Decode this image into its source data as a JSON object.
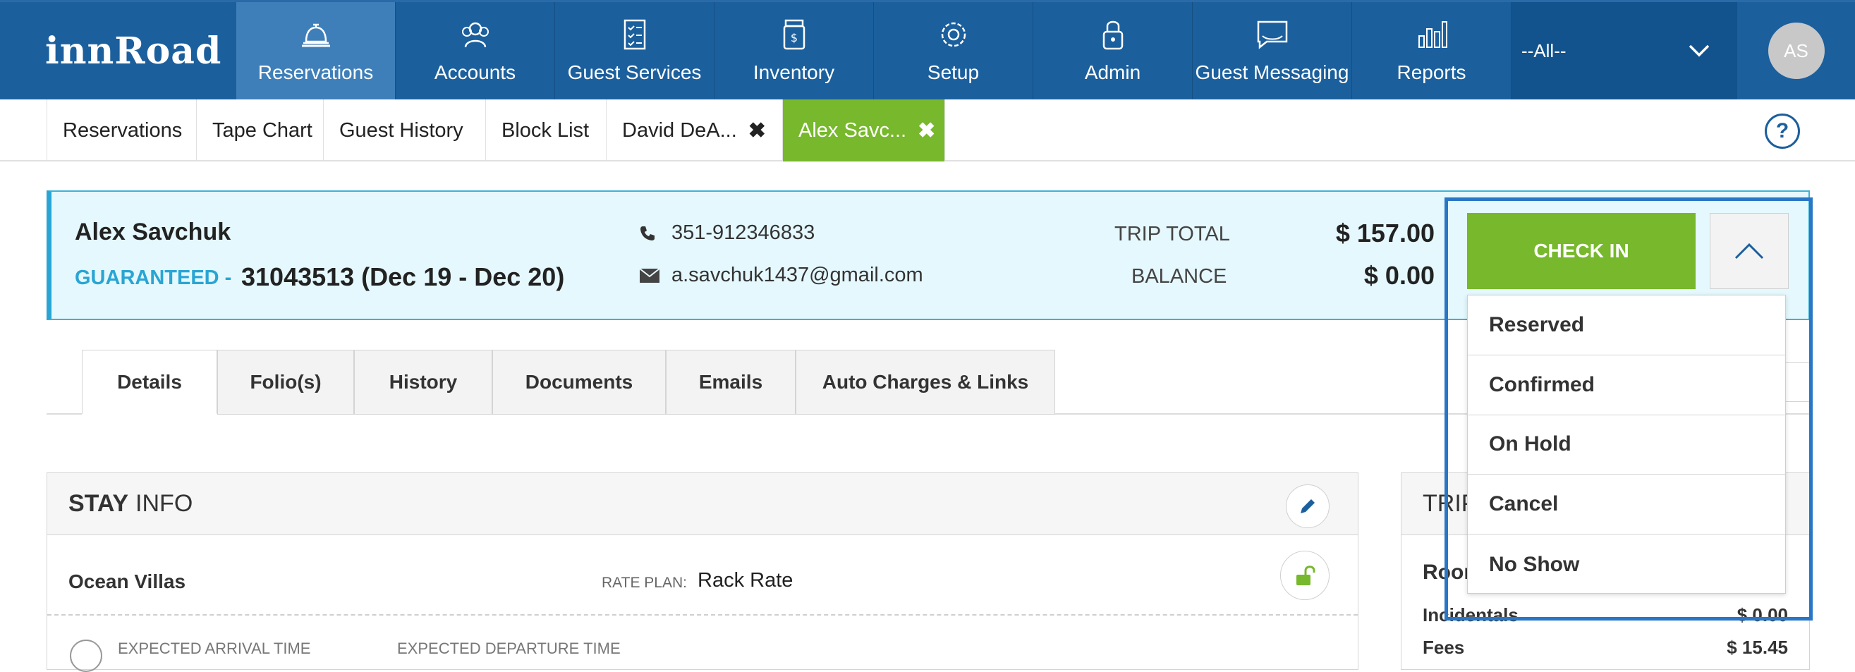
{
  "app": {
    "logo": "innRoad"
  },
  "nav": {
    "items": [
      {
        "label": "Reservations",
        "icon": "bell-icon"
      },
      {
        "label": "Accounts",
        "icon": "people-icon"
      },
      {
        "label": "Guest Services",
        "icon": "checklist-icon"
      },
      {
        "label": "Inventory",
        "icon": "jar-icon"
      },
      {
        "label": "Setup",
        "icon": "gear-icon"
      },
      {
        "label": "Admin",
        "icon": "lock-icon"
      },
      {
        "label": "Guest Messaging",
        "icon": "message-icon"
      },
      {
        "label": "Reports",
        "icon": "bar-chart-icon"
      }
    ],
    "property_select": "--All--",
    "avatar_initials": "AS"
  },
  "tabs": {
    "items": [
      {
        "label": "Reservations"
      },
      {
        "label": "Tape Chart"
      },
      {
        "label": "Guest History"
      },
      {
        "label": "Block List"
      },
      {
        "label": "David DeA...",
        "close": "✖"
      },
      {
        "label": "Alex Savc...",
        "close": "✖"
      }
    ],
    "help": "?"
  },
  "reservation": {
    "guest_name": "Alex Savchuk",
    "status": "GUARANTEED -",
    "number_dates": "31043513 (Dec 19 - Dec 20)",
    "phone": "351-912346833",
    "email": "a.savchuk1437@gmail.com",
    "trip_total_label": "TRIP TOTAL",
    "trip_total": "$ 157.00",
    "balance_label": "BALANCE",
    "balance": "$ 0.00",
    "check_in_label": "CHECK IN"
  },
  "status_menu": {
    "options": [
      "Reserved",
      "Confirmed",
      "On Hold",
      "Cancel",
      "No Show"
    ]
  },
  "detail_tabs": [
    "Details",
    "Folio(s)",
    "History",
    "Documents",
    "Emails",
    "Auto Charges & Links"
  ],
  "stay_info": {
    "title_bold": "STAY",
    "title_rest": "INFO",
    "room_class": "Ocean Villas",
    "rate_plan_label": "RATE PLAN:",
    "rate_plan": "Rack Rate",
    "arrival_label": "EXPECTED ARRIVAL TIME",
    "departure_label": "EXPECTED DEPARTURE TIME"
  },
  "trip_panel": {
    "title_partial": "TRIP",
    "room_partial": "Room",
    "incidentals_label": "Incidentals",
    "incidentals_value": "$ 0.00",
    "fees_label": "Fees",
    "fees_value": "$ 15.45"
  },
  "colors": {
    "nav_bg": "#1b5f9d",
    "nav_active": "#3f7fb9",
    "accent_green": "#77b82c",
    "info_blue": "#29a5d4",
    "header_bg": "#e5f8fd",
    "highlight": "#2a76c6"
  }
}
